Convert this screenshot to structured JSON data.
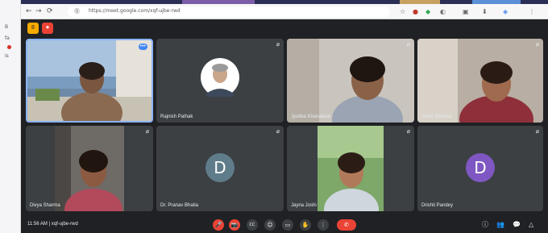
{
  "browser": {
    "url": "https://meet.google.com/xqf-ujbe-rwd",
    "nav": {
      "back": "←",
      "forward": "→",
      "reload": "⟳",
      "lock": "⓪"
    },
    "extensions": [
      "☆",
      "●",
      "◆",
      "◐",
      "▣",
      "⬇",
      "◈",
      "⋮"
    ]
  },
  "left_strip": {
    "items": [
      "B",
      "fa",
      "is"
    ]
  },
  "header": {
    "badge_label": "8",
    "record_label": "⏺"
  },
  "tiles": [
    {
      "name": "",
      "type": "video",
      "scene": "balcony",
      "pinned": true
    },
    {
      "name": "Rajnish Pathak",
      "type": "photo"
    },
    {
      "name": "Jyotika Khandekar",
      "type": "video",
      "scene": "room-light"
    },
    {
      "name": "Ishita Sharma",
      "type": "video",
      "scene": "room-warm"
    },
    {
      "name": "Divya Sharma",
      "type": "video",
      "scene": "car"
    },
    {
      "name": "Dr. Pranav Bhatia",
      "type": "avatar",
      "initial": "D",
      "color": "#5f7c8a"
    },
    {
      "name": "Jayna Joshi",
      "type": "video",
      "scene": "garden"
    },
    {
      "name": "Drishti Pandey",
      "type": "avatar",
      "initial": "D",
      "color": "#7e57c2"
    }
  ],
  "bottom": {
    "meeting_info": "11:56 AM  |  xqf-ujbe-rwd",
    "controls": [
      "🎤",
      "📷",
      "CC",
      "☺",
      "▭",
      "✋",
      "⋮"
    ],
    "leave_icon": "✆",
    "right_icons": [
      "ⓘ",
      "👥",
      "💬",
      "△"
    ]
  },
  "colors": {
    "meet_bg": "#202124",
    "tile_bg": "#3c4043",
    "red": "#ea4335",
    "accent_yellow": "#f9ab00",
    "pinned_border": "#8ab4f8"
  }
}
